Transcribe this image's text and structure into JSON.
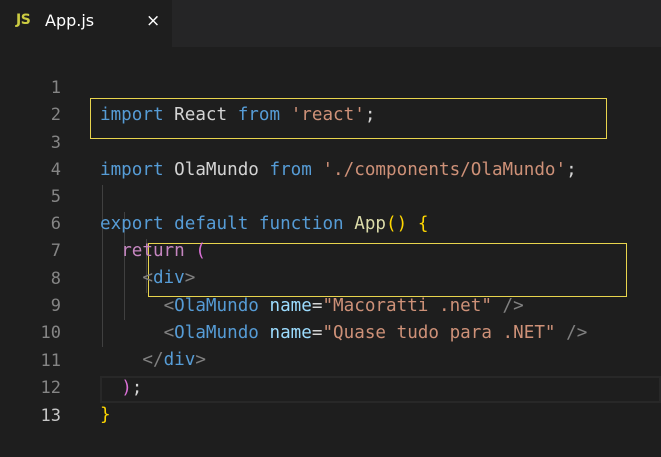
{
  "tab": {
    "icon": "JS",
    "filename": "App.js",
    "close": "×"
  },
  "lines": [
    {
      "n": "1",
      "tokens": [
        "import",
        " ",
        "React",
        " ",
        "from",
        " ",
        "'react'",
        ";"
      ]
    },
    {
      "n": "2"
    },
    {
      "n": "3",
      "tokens": [
        "import",
        " ",
        "OlaMundo",
        " ",
        "from",
        " ",
        "'./components/OlaMundo'",
        ";"
      ]
    },
    {
      "n": "4"
    },
    {
      "n": "5",
      "tokens": [
        "export",
        " ",
        "default",
        " ",
        "function",
        " ",
        "App",
        "(",
        ")",
        " ",
        "{"
      ]
    },
    {
      "n": "6",
      "tokens": [
        "  ",
        "return",
        " ",
        "("
      ]
    },
    {
      "n": "7",
      "tokens": [
        "    ",
        "<",
        "div",
        ">"
      ]
    },
    {
      "n": "8",
      "tokens": [
        "      ",
        "<",
        "OlaMundo",
        " ",
        "name",
        "=",
        "\"Macoratti .net\"",
        " ",
        "/>"
      ]
    },
    {
      "n": "9",
      "tokens": [
        "      ",
        "<",
        "OlaMundo",
        " ",
        "name",
        "=",
        "\"Quase tudo para .NET\"",
        " ",
        "/>"
      ]
    },
    {
      "n": "10",
      "tokens": [
        "    ",
        "</",
        "div",
        ">"
      ]
    },
    {
      "n": "11",
      "tokens": [
        "  ",
        ")",
        ";"
      ]
    },
    {
      "n": "12",
      "tokens": [
        "}"
      ]
    },
    {
      "n": "13"
    }
  ],
  "colors": {
    "background": "#1e1e1e",
    "keyword": "#569cd6",
    "control": "#c586c0",
    "string": "#ce9178",
    "function": "#dcdcaa",
    "attribute": "#9cdcfe",
    "highlight_box": "#e8d44d"
  },
  "icons": {
    "file_icon": "javascript-file-icon",
    "close_icon": "close-icon"
  }
}
